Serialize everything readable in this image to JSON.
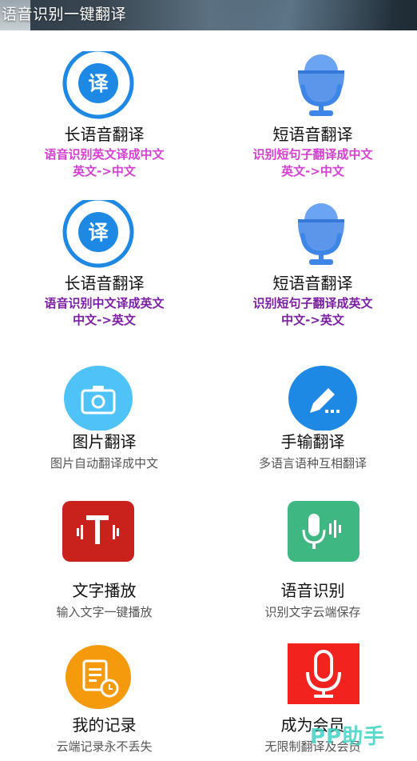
{
  "header": {
    "title": "语音识别一键翻译"
  },
  "grid": [
    {
      "title": "长语音翻译",
      "sub1": "语音识别英文译成中文",
      "sub2": "英文->中文",
      "sub_color": "#d33fd0",
      "icon": "translate-circle-icon"
    },
    {
      "title": "短语音翻译",
      "sub1": "识别短句子翻译成中文",
      "sub2": "英文->中文",
      "sub_color": "#d33fd0",
      "icon": "microphone-icon"
    },
    {
      "title": "长语音翻译",
      "sub1": "语音识别中文译成英文",
      "sub2": "中文->英文",
      "sub_color": "#7a1fa2",
      "icon": "translate-circle-icon"
    },
    {
      "title": "短语音翻译",
      "sub1": "识别短句子翻译成英文",
      "sub2": "中文->英文",
      "sub_color": "#7a1fa2",
      "icon": "microphone-icon"
    },
    {
      "title": "图片翻译",
      "desc": "图片自动翻译成中文",
      "icon": "camera-icon"
    },
    {
      "title": "手输翻译",
      "desc": "多语言语种互相翻译",
      "icon": "pen-icon"
    },
    {
      "title": "文字播放",
      "desc": "输入文字一键播放",
      "icon": "text-audio-icon"
    },
    {
      "title": "语音识别",
      "desc": "识别文字云端保存",
      "icon": "voice-wave-icon"
    },
    {
      "title": "我的记录",
      "desc": "云端记录永不丢失",
      "icon": "record-icon"
    },
    {
      "title": "成为会员",
      "desc": "无限制翻译及会员",
      "icon": "microphone-membership-icon"
    }
  ],
  "watermark": "PP助手",
  "colors": {
    "blue": "#1e88e5",
    "light_blue": "#4fc3f7",
    "mic_blue": "#6aa4f2",
    "red_dark": "#c9211b",
    "green": "#3fb782",
    "orange": "#f59a0c",
    "red_bright": "#f2221f"
  }
}
